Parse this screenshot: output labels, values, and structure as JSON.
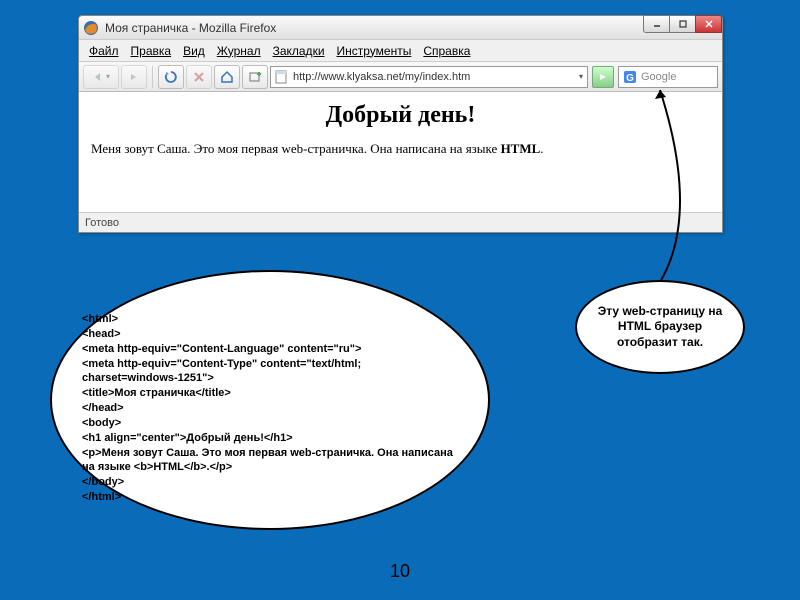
{
  "window": {
    "title": "Моя страничка - Mozilla Firefox",
    "menus": [
      "Файл",
      "Правка",
      "Вид",
      "Журнал",
      "Закладки",
      "Инструменты",
      "Справка"
    ],
    "url": "http://www.klyaksa.net/my/index.htm",
    "search_placeholder": "Google",
    "status": "Готово"
  },
  "page": {
    "heading": "Добрый день!",
    "para_pre": "Меня зовут Саша. Это моя первая web-страничка. Она написана на языке ",
    "para_bold": "HTML",
    "para_post": "."
  },
  "code_lines": [
    "<html>",
    "<head>",
    "<meta http-equiv=\"Content-Language\" content=\"ru\">",
    "<meta http-equiv=\"Content-Type\" content=\"text/html; charset=windows-1251\">",
    "<title>Моя страничка</title>",
    "</head>",
    "<body>",
    "<h1 align=\"center\">Добрый день!</h1>",
    "<p>Меня зовут Саша. Это моя первая web-страничка. Она написана на языке <b>HTML</b>.</p>",
    "</body>",
    "</html>"
  ],
  "note": "Эту web-страницу на HTML браузер отобразит так.",
  "slide_number": "10"
}
